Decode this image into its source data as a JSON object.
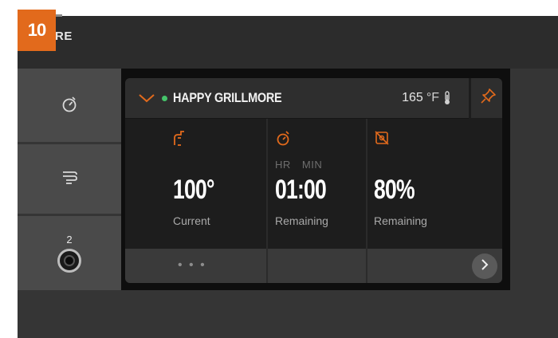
{
  "step_badge": "10",
  "brand_partial": "RE",
  "colors": {
    "accent": "#e26a1c",
    "status_dot": "#45c46a"
  },
  "sidebar": {
    "items": [
      {
        "icon": "stopwatch-icon"
      },
      {
        "icon": "smoke-icon"
      },
      {
        "icon": "probe-jack-icon",
        "count": "2"
      }
    ]
  },
  "card": {
    "title": "HAPPY GRILLMORE",
    "status": "connected",
    "temp_value": "165",
    "temp_unit": "°F",
    "columns": [
      {
        "icon": "probe-icon",
        "value": "100°",
        "label": "Current"
      },
      {
        "icon": "timer-icon",
        "units": "HR   MIN",
        "value": "01:00",
        "label": "Remaining"
      },
      {
        "icon": "pellet-fan-icon",
        "value": "80%",
        "label": "Remaining"
      }
    ],
    "more": "• • •"
  }
}
